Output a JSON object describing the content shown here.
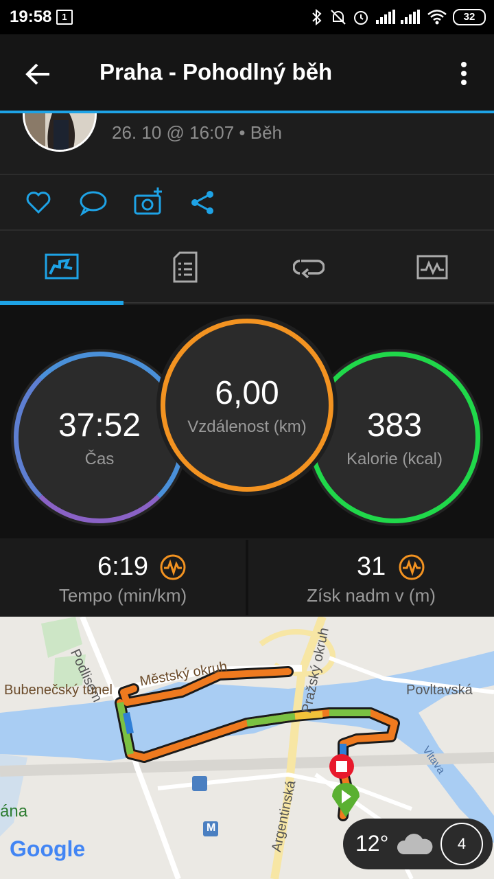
{
  "status_bar": {
    "time": "19:58",
    "notification_count": "1",
    "battery": "32"
  },
  "app_bar": {
    "title": "Praha - Pohodlný běh"
  },
  "activity": {
    "subtitle": "26. 10 @ 16:07 • Běh"
  },
  "metrics": {
    "time": {
      "value": "37:52",
      "label": "Čas"
    },
    "distance": {
      "value": "6,00",
      "label": "Vzdálenost (km)"
    },
    "calories": {
      "value": "383",
      "label": "Kalorie (kcal)"
    }
  },
  "stats": {
    "pace": {
      "value": "6:19",
      "label": "Tempo (min/km)"
    },
    "elevation": {
      "value": "31",
      "label": "Získ nadm v (m)"
    }
  },
  "map": {
    "labels": {
      "podlisem": "Podlisem",
      "bubenecsky": "Bubenečský tunel",
      "mestsky": "Městský okruh",
      "prazsky": "Pražský okruh",
      "povltavska": "Povltavská",
      "vltava": "Vltava",
      "argentinska": "Argentinská",
      "ana": "ána",
      "metro": "M"
    },
    "google": "Google"
  },
  "weather": {
    "temperature": "12°",
    "wind": "4"
  },
  "colors": {
    "accent": "#1ea3e6",
    "time_ring": "#4a90d9",
    "distance_ring": "#f39321",
    "calorie_ring": "#20d84a",
    "badge": "#f39321"
  }
}
